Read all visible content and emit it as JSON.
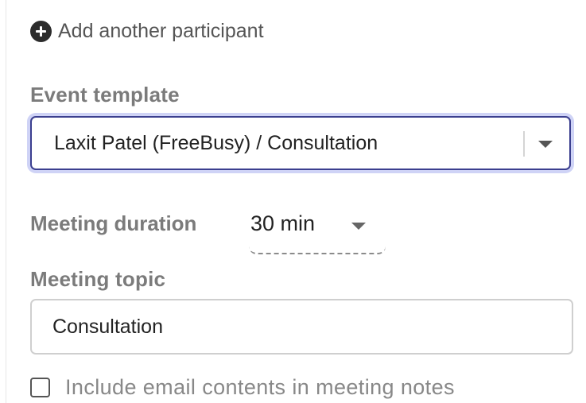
{
  "participants": {
    "add_label": "Add another participant",
    "add_icon": "plus-circle-icon"
  },
  "event_template": {
    "label": "Event template",
    "selected_value": "Laxit Patel (FreeBusy) / Consultation",
    "accent_border": "#3b3f8f",
    "focus_ring": "#cfd3f6"
  },
  "meeting_duration": {
    "label": "Meeting duration",
    "selected_value": "30 min"
  },
  "meeting_topic": {
    "label": "Meeting topic",
    "value": "Consultation"
  },
  "include_email": {
    "label": "Include email contents in meeting notes",
    "checked": false
  }
}
